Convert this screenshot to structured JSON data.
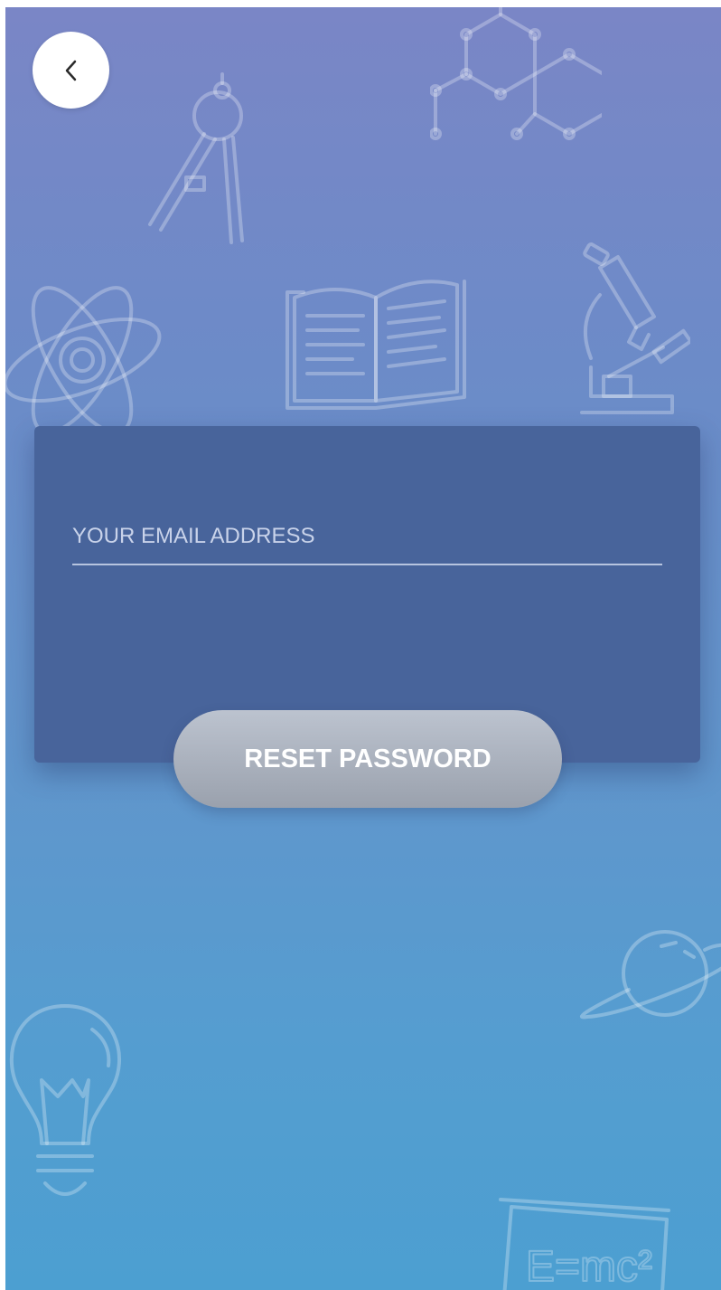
{
  "header": {
    "back_icon": "chevron-left-icon"
  },
  "form": {
    "email_placeholder": "YOUR EMAIL ADDRESS",
    "email_value": "",
    "reset_label": "RESET PASSWORD"
  },
  "background_icons": [
    "molecule-icon",
    "compass-icon",
    "atom-icon",
    "book-icon",
    "microscope-icon",
    "planet-icon",
    "lightbulb-icon",
    "chalkboard-icon"
  ],
  "colors": {
    "gradient_top": "#7a86c6",
    "gradient_bottom": "#4c9fd1",
    "card": "#48649b",
    "button_top": "#bcc3cf",
    "button_bottom": "#9aa1ad"
  }
}
